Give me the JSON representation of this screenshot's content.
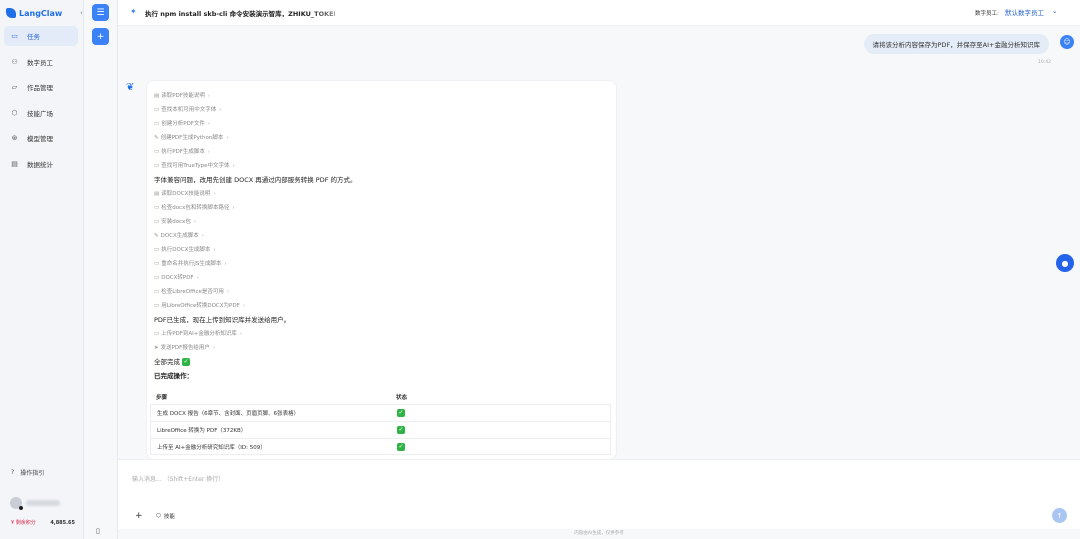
{
  "app": {
    "name": "LangClaw"
  },
  "sidebar": {
    "items": [
      {
        "label": "任务",
        "icon": "chat-icon",
        "active": true
      },
      {
        "label": "数字员工",
        "icon": "people-icon"
      },
      {
        "label": "作品管理",
        "icon": "folder-icon"
      },
      {
        "label": "技能广场",
        "icon": "cube-icon"
      },
      {
        "label": "模型管理",
        "icon": "model-icon"
      },
      {
        "label": "数据统计",
        "icon": "chart-icon"
      }
    ],
    "guide_label": "操作指引",
    "points_label": "剩余积分",
    "points_value": "4,885.65"
  },
  "header": {
    "title": "执行 npm install skb-cli 命令安装演示智库，ZHIKU_TOKEN",
    "employee_label": "数字员工:",
    "employee_value": "默认数字员工"
  },
  "chat": {
    "user_message": "请将该分析内容保存为PDF，并保存至AI+金融分析知识库",
    "user_message_time": "10:42",
    "blocks": [
      {
        "kind": "step",
        "icon": "doc-icon",
        "text": "读取PDF技能说明"
      },
      {
        "kind": "step",
        "icon": "terminal-icon",
        "text": "查找本机可用中文字体"
      },
      {
        "kind": "step",
        "icon": "terminal-icon",
        "text": "创建分析PDF文件"
      },
      {
        "kind": "step",
        "icon": "edit-icon",
        "text": "创建PDF生成Python脚本"
      },
      {
        "kind": "step",
        "icon": "terminal-icon",
        "text": "执行PDF生成脚本"
      },
      {
        "kind": "step",
        "icon": "terminal-icon",
        "text": "查找可用TrueType中文字体"
      },
      {
        "kind": "para",
        "text": "字体兼容问题，改用先创建 DOCX 再通过内部服务转换 PDF 的方式。"
      },
      {
        "kind": "step",
        "icon": "doc-icon",
        "text": "读取DOCX技能说明"
      },
      {
        "kind": "step",
        "icon": "terminal-icon",
        "text": "检查docx包和转换脚本路径"
      },
      {
        "kind": "step",
        "icon": "terminal-icon",
        "text": "安装docx包"
      },
      {
        "kind": "step",
        "icon": "edit-icon",
        "text": "DOCX生成脚本"
      },
      {
        "kind": "step",
        "icon": "terminal-icon",
        "text": "执行DOCX生成脚本"
      },
      {
        "kind": "step",
        "icon": "terminal-icon",
        "text": "重命名并执行JS生成脚本"
      },
      {
        "kind": "step",
        "icon": "terminal-icon",
        "text": "DOCX转PDF"
      },
      {
        "kind": "step",
        "icon": "terminal-icon",
        "text": "检查LibreOffice是否可用"
      },
      {
        "kind": "step",
        "icon": "terminal-icon",
        "text": "用LibreOffice转换DOCX为PDF"
      },
      {
        "kind": "para",
        "text": "PDF已生成，现在上传到知识库并发送给用户。"
      },
      {
        "kind": "step",
        "icon": "terminal-icon",
        "text": "上传PDF到AI+金融分析知识库"
      },
      {
        "kind": "step",
        "icon": "send-icon",
        "text": "发送PDF报告给用户"
      },
      {
        "kind": "done",
        "text": "全部完成"
      },
      {
        "kind": "bold",
        "text": "已完成操作："
      }
    ],
    "table": {
      "headers": [
        "步骤",
        "状态"
      ],
      "rows": [
        [
          "生成 DOCX 报告（6章节、含封面、页眉页脚、6张表格）",
          "✓"
        ],
        [
          "LibreOffice 转换为 PDF（372KB）",
          "✓"
        ],
        [
          "上传至 AI+金融分析研究知识库（ID: 509）",
          "✓"
        ]
      ]
    }
  },
  "input": {
    "placeholder": "输入消息... （Shift+Enter 换行）",
    "skill_label": "技能"
  },
  "footer": "内容由AI生成，仅供参考"
}
